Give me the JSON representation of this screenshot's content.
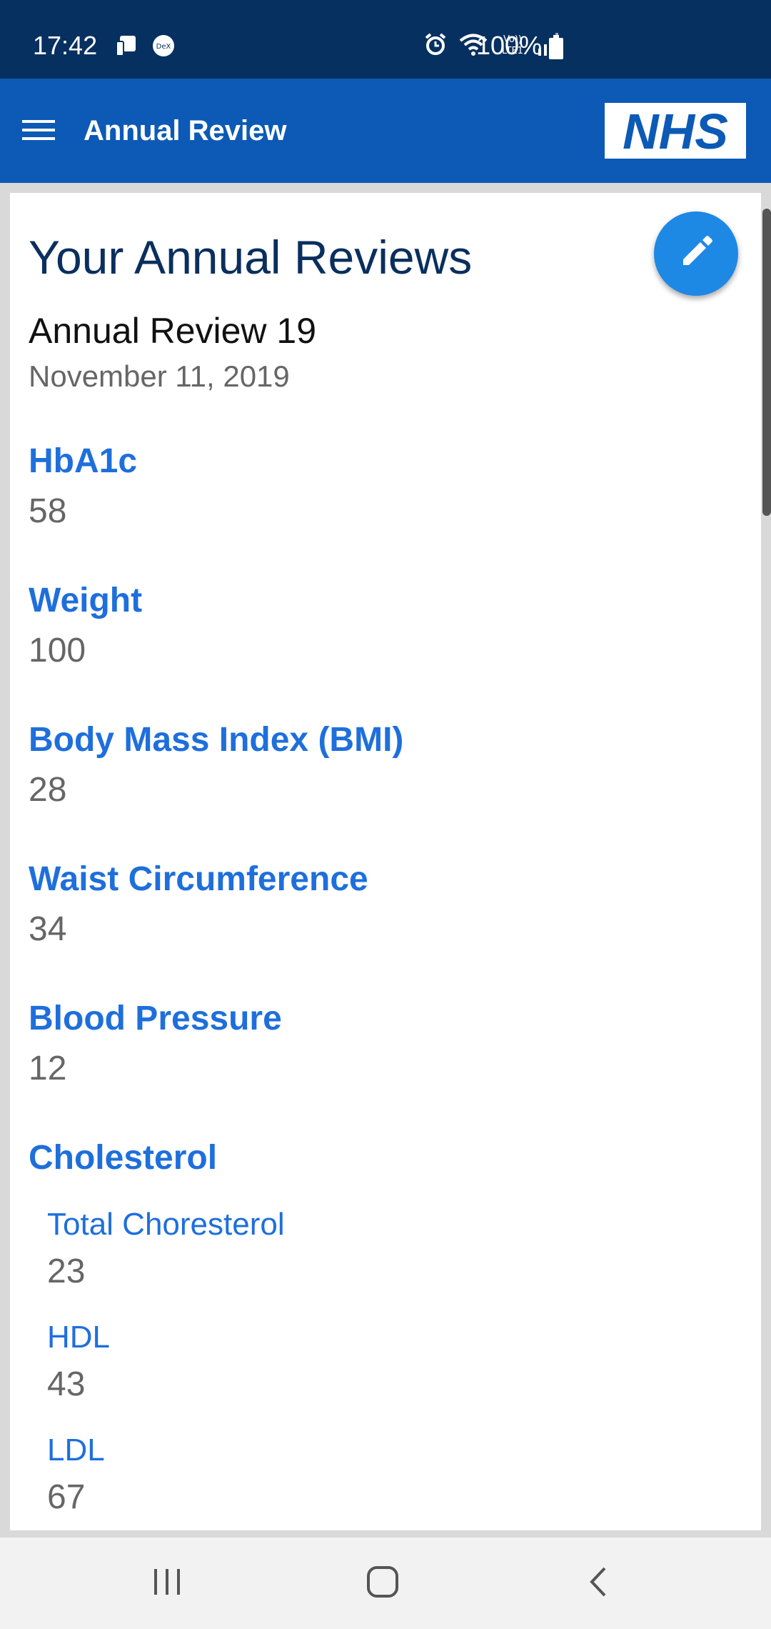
{
  "status_bar": {
    "time": "17:42",
    "battery_text": "100%",
    "icons": [
      "device-icon",
      "dex-icon",
      "alarm-icon",
      "wifi-icon",
      "volte-icon",
      "signal-icon",
      "battery-icon"
    ]
  },
  "app_bar": {
    "title": "Annual Review",
    "logo_text": "NHS",
    "icons": [
      "menu-icon"
    ]
  },
  "colors": {
    "status_bar": "#06305f",
    "app_bar": "#0c5ab6",
    "accent": "#1e88e5",
    "label_blue": "#1e6fdc",
    "title_navy": "#0a2f5e"
  },
  "main": {
    "page_title": "Your Annual Reviews",
    "fab_icon": "edit-pencil-icon",
    "review_name": "Annual Review 19",
    "review_date": "November 11, 2019",
    "metrics": [
      {
        "label": "HbA1c",
        "value": "58"
      },
      {
        "label": "Weight",
        "value": "100"
      },
      {
        "label": "Body Mass Index (BMI)",
        "value": "28"
      },
      {
        "label": "Waist Circumference",
        "value": "34"
      },
      {
        "label": "Blood Pressure",
        "value": "12"
      }
    ],
    "cholesterol": {
      "label": "Cholesterol",
      "items": [
        {
          "label": "Total Choresterol",
          "value": "23"
        },
        {
          "label": "HDL",
          "value": "43"
        },
        {
          "label": "LDL",
          "value": "67"
        }
      ]
    }
  },
  "nav_bar": {
    "icons": [
      "recent-apps-icon",
      "home-icon",
      "back-icon"
    ]
  }
}
